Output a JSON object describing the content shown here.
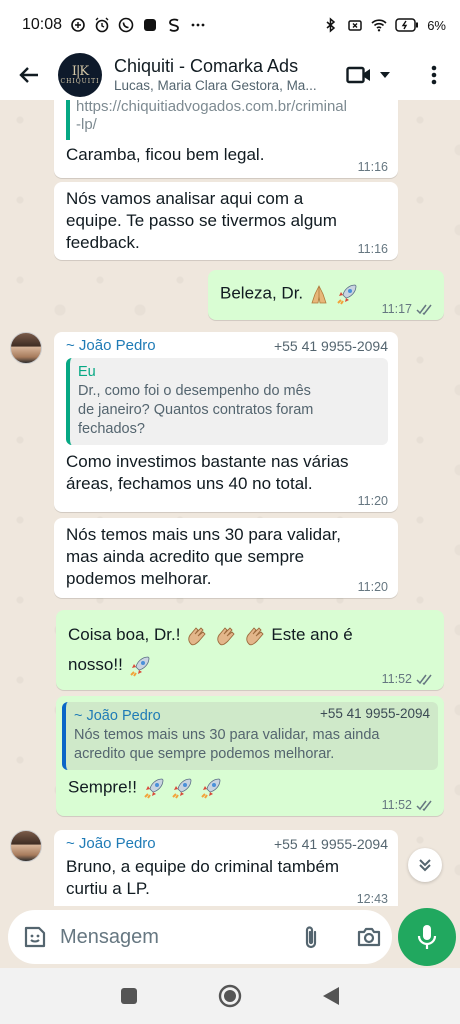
{
  "status_bar": {
    "time": "10:08",
    "battery_text": "6%"
  },
  "header": {
    "avatar_text": "CHIQUITI",
    "title": "Chiquiti - Comarka Ads",
    "subtitle": "Lucas, Maria Clara Gestora, Ma..."
  },
  "messages": [
    {
      "link": "https://chiquitiadvogados.com.br/criminal-lp/",
      "link_line1": "https://chiquitiadvogados.com.br/criminal",
      "link_line2": "-lp/",
      "text": "Caramba, ficou bem legal.",
      "time": "11:16"
    },
    {
      "text_line1": "Nós vamos analisar aqui com a",
      "text_line2": "equipe. Te passo se tivermos algum",
      "text_line3": "feedback.",
      "time": "11:16"
    },
    {
      "text": "Beleza, Dr.",
      "time": "11:17"
    },
    {
      "sender": "~ João Pedro",
      "phone": "+55 41 9955-2094",
      "quote_author": "Eu",
      "quote_line1": "Dr., como foi o desempenho do mês",
      "quote_line2": "de janeiro? Quantos contratos foram",
      "quote_line3": "fechados?",
      "text_line1": "Como investimos bastante nas várias",
      "text_line2": "áreas, fechamos uns 40 no total.",
      "time": "11:20"
    },
    {
      "text_line1": "Nós temos mais uns 30 para validar,",
      "text_line2": "mas ainda acredito que sempre",
      "text_line3": "podemos melhorar.",
      "time": "11:20"
    },
    {
      "text_line1": "Coisa boa, Dr.!",
      "text_line1_after": "Este ano é",
      "text_line2": "nosso!!",
      "time": "11:52"
    },
    {
      "quote_author": "~ João Pedro",
      "quote_phone": "+55 41 9955-2094",
      "quote_line1": "Nós temos mais uns 30 para validar, mas ainda",
      "quote_line2": "acredito que sempre podemos melhorar.",
      "text": "Sempre!!",
      "time": "11:52"
    },
    {
      "sender": "~ João Pedro",
      "phone": "+55 41 9955-2094",
      "text_line1": "Bruno, a equipe do criminal também",
      "text_line2": "curtiu a LP.",
      "time": "12:43"
    }
  ],
  "composer": {
    "placeholder": "Mensagem"
  },
  "icons": {
    "back": "arrow-left",
    "video": "video-camera",
    "menu": "more-vertical",
    "sticker": "sticker",
    "attach": "paperclip",
    "camera": "camera",
    "mic": "microphone"
  },
  "colors": {
    "outgoing": "#d9fdd3",
    "incoming": "#ffffff",
    "accent": "#21a85f",
    "sender": "#1f7bb6",
    "wallpaper": "#efe7dd"
  }
}
